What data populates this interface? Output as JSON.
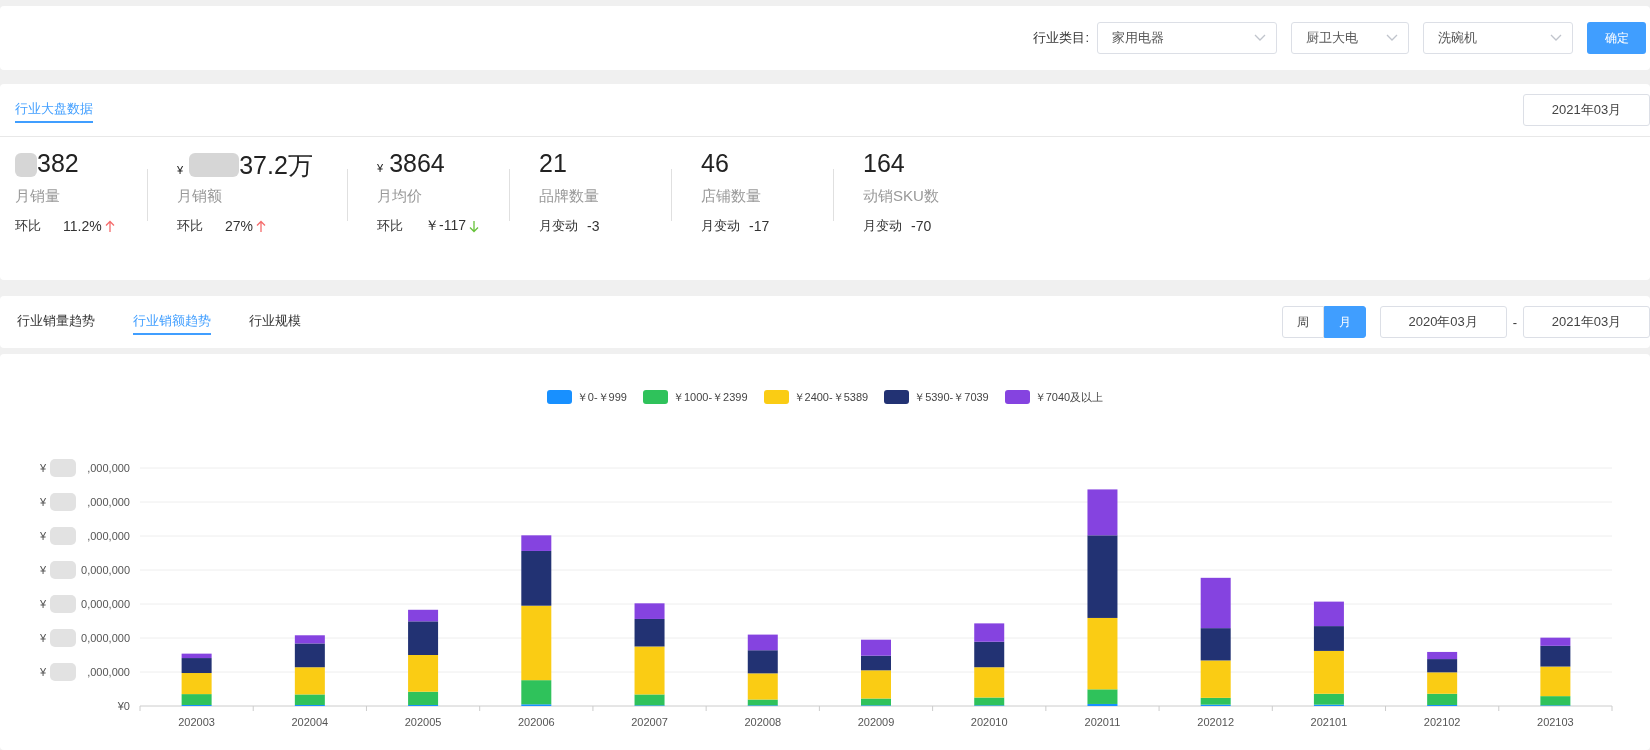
{
  "filter_bar": {
    "label": "行业类目:",
    "selects": [
      {
        "value": "家用电器"
      },
      {
        "value": "厨卫大电"
      },
      {
        "value": "洗碗机"
      }
    ],
    "confirm": "确定"
  },
  "overview": {
    "tab": {
      "label": "行业大盘数据",
      "selected": true
    },
    "date": "2021年03月",
    "kpis": [
      {
        "value": "382",
        "blurred": true,
        "label": "月销量",
        "change_label": "环比",
        "change": "11.2%",
        "trend_up": true
      },
      {
        "currency": "¥",
        "value": "37.2万",
        "blurred": true,
        "label": "月销额",
        "change_label": "环比",
        "change": "27%",
        "trend_up": true
      },
      {
        "currency": "¥",
        "value": "3864",
        "label": "月均价",
        "change_label": "环比",
        "change": "￥-117",
        "trend_up": false
      },
      {
        "value": "21",
        "label": "品牌数量",
        "change_label": "月变动",
        "change": "-3"
      },
      {
        "value": "46",
        "label": "店铺数量",
        "change_label": "月变动",
        "change": "-17"
      },
      {
        "value": "164",
        "label": "动销SKU数",
        "change_label": "月变动",
        "change": "-70"
      }
    ]
  },
  "trend_tabs": [
    {
      "label": "行业销量趋势",
      "selected": false
    },
    {
      "label": "行业销额趋势",
      "selected": true
    },
    {
      "label": "行业规模",
      "selected": false
    }
  ],
  "period": [
    {
      "label": "周",
      "selected": false
    },
    {
      "label": "月",
      "selected": true
    }
  ],
  "date_range": {
    "start": "2020年03月",
    "separator": "-",
    "end": "2021年03月"
  },
  "chart": {
    "legend": [
      {
        "label": "￥0-￥999",
        "color": "#1890ff"
      },
      {
        "label": "￥1000-￥2399",
        "color": "#2fc25b"
      },
      {
        "label": "￥2400-￥5389",
        "color": "#facc14"
      },
      {
        "label": "￥5390-￥7039",
        "color": "#223273"
      },
      {
        "label": "￥7040及以上",
        "color": "#8543e0"
      }
    ],
    "y_labels": [
      {
        "prefix": "¥",
        "text": ",000,000",
        "blurred": true
      },
      {
        "prefix": "¥",
        "text": ",000,000",
        "blurred": true
      },
      {
        "prefix": "¥",
        "text": ",000,000",
        "blurred": true
      },
      {
        "prefix": "¥",
        "text": "0,000,000",
        "blurred": true
      },
      {
        "prefix": "¥",
        "text": "0,000,000",
        "blurred": true
      },
      {
        "prefix": "¥",
        "text": "0,000,000",
        "blurred": true
      },
      {
        "prefix": "¥",
        "text": ",000,000",
        "blurred": true
      },
      {
        "prefix": "¥",
        "text": "0",
        "blurred": false
      }
    ],
    "x_labels": [
      "202003",
      "202004",
      "202005",
      "202006",
      "202007",
      "202008",
      "202009",
      "202010",
      "202011",
      "202012",
      "202101",
      "202102",
      "202103"
    ]
  }
}
